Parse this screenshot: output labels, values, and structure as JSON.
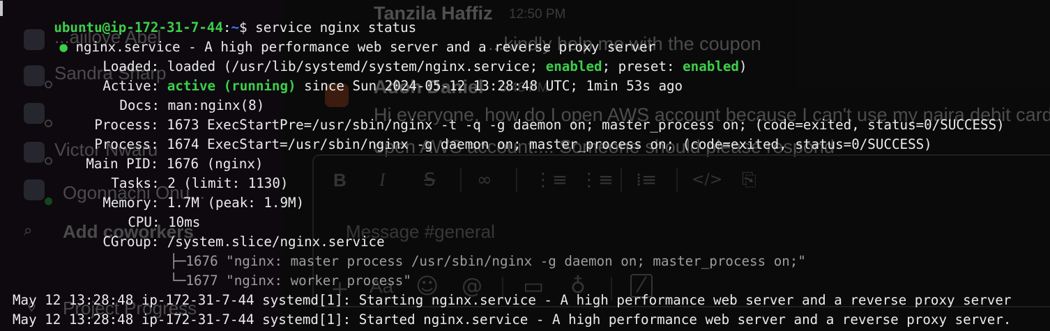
{
  "terminal": {
    "prompt": {
      "user_host": "ubuntu@ip-172-31-7-44",
      "separator": ":",
      "path": "~",
      "symbol": "$",
      "command": "service nginx status"
    },
    "service_header": {
      "bullet": "●",
      "text": "nginx.service - A high performance web server and a reverse proxy server"
    },
    "loaded": {
      "label": "Loaded:",
      "pre": "loaded (/usr/lib/systemd/system/nginx.service;",
      "state1": "enabled",
      "mid": "; preset:",
      "state2": "enabled",
      "post": ")"
    },
    "active": {
      "label": "Active:",
      "state": "active (running)",
      "rest": "since Sun 2024-05-12 13:28:48 UTC; 1min 53s ago"
    },
    "fields": [
      {
        "label": "Docs:",
        "value": "man:nginx(8)"
      },
      {
        "label": "Process:",
        "value": "1673 ExecStartPre=/usr/sbin/nginx -t -q -g daemon on; master_process on; (code=exited, status=0/SUCCESS)"
      },
      {
        "label": "Process:",
        "value": "1674 ExecStart=/usr/sbin/nginx -g daemon on; master_process on; (code=exited, status=0/SUCCESS)"
      },
      {
        "label": "Main PID:",
        "value": "1676 (nginx)"
      },
      {
        "label": "Tasks:",
        "value": "2 (limit: 1130)"
      },
      {
        "label": "Memory:",
        "value": "1.7M (peak: 1.9M)"
      },
      {
        "label": "CPU:",
        "value": "10ms"
      },
      {
        "label": "CGroup:",
        "value": "/system.slice/nginx.service"
      }
    ],
    "cgroup_tree": [
      {
        "branch": "├─",
        "text": "1676 \"nginx: master process /usr/sbin/nginx -g daemon on; master_process on;\""
      },
      {
        "branch": "└─",
        "text": "1677 \"nginx: worker process\""
      }
    ],
    "log_lines": [
      "May 12 13:28:48 ip-172-31-7-44 systemd[1]: Starting nginx.service - A high performance web server and a reverse proxy server",
      "May 12 13:28:48 ip-172-31-7-44 systemd[1]: Started nginx.service - A high performance web server and a reverse proxy server."
    ]
  },
  "background_slack": {
    "sidebar_items": [
      "...ajiloye Abel",
      "Sandra Sharp",
      "Victor Nwaru",
      "Ogonnachi Onu...",
      "Add coworkers",
      "Project Progress"
    ],
    "messages": [
      {
        "name": "Tanzila Haffiz",
        "time": "12:50 PM",
        "text": "...kindly help me with the coupon"
      },
      {
        "name": "Adoh Daniel",
        "time": "6:46 PM",
        "text": "Hi everyone, how do I open AWS account because I can't use my naira debit card to",
        "text2": "open AWS account.... Someone should please respond"
      }
    ],
    "composer_placeholder": "Message #general",
    "toolbar_icons": [
      "bold-icon",
      "italic-icon",
      "strikethrough-icon",
      "link-icon",
      "ordered-list-icon",
      "bulleted-list-icon",
      "blockquote-icon",
      "code-icon",
      "code-block-icon"
    ],
    "bottom_icons": [
      "plus-icon",
      "format-icon",
      "emoji-icon",
      "mention-icon",
      "video-icon",
      "microphone-icon",
      "slash-icon"
    ],
    "bottom_glyphs": {
      "plus": "+",
      "format": "Aa",
      "emoji": "☺",
      "mention": "@",
      "video": "▭",
      "microphone": "♁",
      "slash": "⁄"
    },
    "toolbar_glyphs": {
      "bold": "B",
      "italic": "I",
      "strike": "S",
      "link": "∞",
      "ol": "⋮≡",
      "ul": "⋮≡",
      "quote": "⁞≡",
      "code": "</>",
      "codeblock": "⎘"
    }
  },
  "colors": {
    "terminal_green": "#3ccf4a",
    "prompt_blue": "#3b78ff",
    "terminal_text": "#ececec"
  }
}
